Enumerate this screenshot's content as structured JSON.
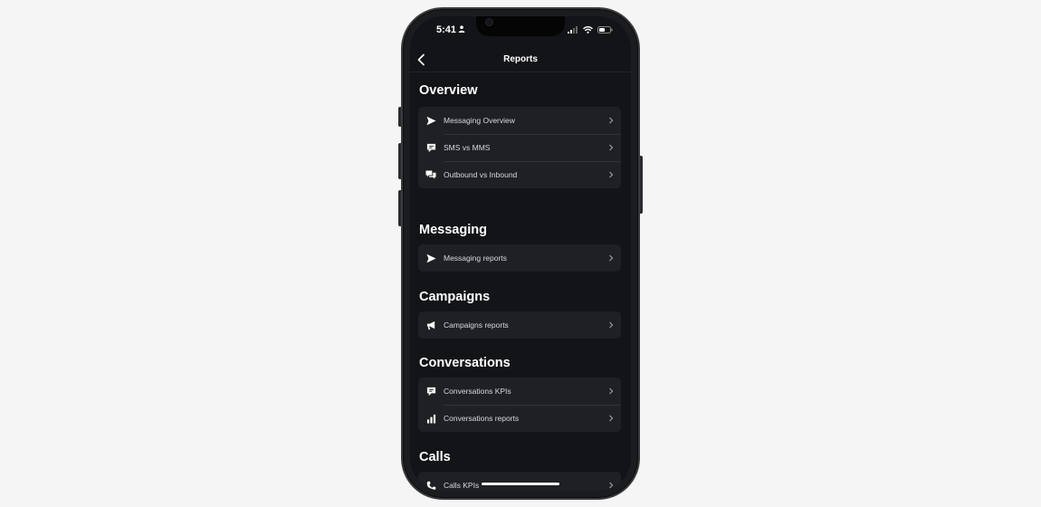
{
  "status": {
    "time": "5:41"
  },
  "nav": {
    "title": "Reports"
  },
  "sections": [
    {
      "title": "Overview",
      "items": [
        {
          "label": "Messaging Overview",
          "icon": "send-icon"
        },
        {
          "label": "SMS vs MMS",
          "icon": "chat-bubble-icon"
        },
        {
          "label": "Outbound vs Inbound",
          "icon": "chat-bubbles-icon"
        }
      ]
    },
    {
      "title": "Messaging",
      "items": [
        {
          "label": "Messaging reports",
          "icon": "send-icon"
        }
      ]
    },
    {
      "title": "Campaigns",
      "items": [
        {
          "label": "Campaigns reports",
          "icon": "megaphone-icon"
        }
      ]
    },
    {
      "title": "Conversations",
      "items": [
        {
          "label": "Conversations KPIs",
          "icon": "chat-bubble-icon"
        },
        {
          "label": "Conversations reports",
          "icon": "bar-chart-icon"
        }
      ]
    },
    {
      "title": "Calls",
      "items": [
        {
          "label": "Calls KPIs",
          "icon": "phone-icon"
        }
      ]
    }
  ],
  "colors": {
    "background": "#131417",
    "card": "#1e2024",
    "text": "#d8d9dc"
  }
}
